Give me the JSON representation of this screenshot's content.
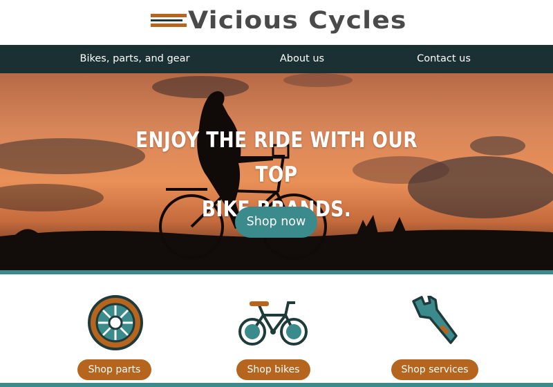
{
  "brand": {
    "name": "Vicious Cycles"
  },
  "nav": {
    "items": [
      {
        "label": "Bikes, parts, and gear"
      },
      {
        "label": "About us"
      },
      {
        "label": "Contact us"
      }
    ]
  },
  "hero": {
    "title_line1": "ENJOY THE RIDE WITH OUR TOP",
    "title_line2": "BIKE BRANDS.",
    "cta_label": "Shop now"
  },
  "categories": [
    {
      "label": "Shop parts",
      "icon": "wheel-icon"
    },
    {
      "label": "Shop bikes",
      "icon": "bike-icon"
    },
    {
      "label": "Shop services",
      "icon": "wrench-icon"
    }
  ],
  "colors": {
    "accent_orange": "#b5651d",
    "accent_teal": "#3b8a8c",
    "nav_bg": "#1a3033",
    "logo_text": "#4a4a4a"
  }
}
